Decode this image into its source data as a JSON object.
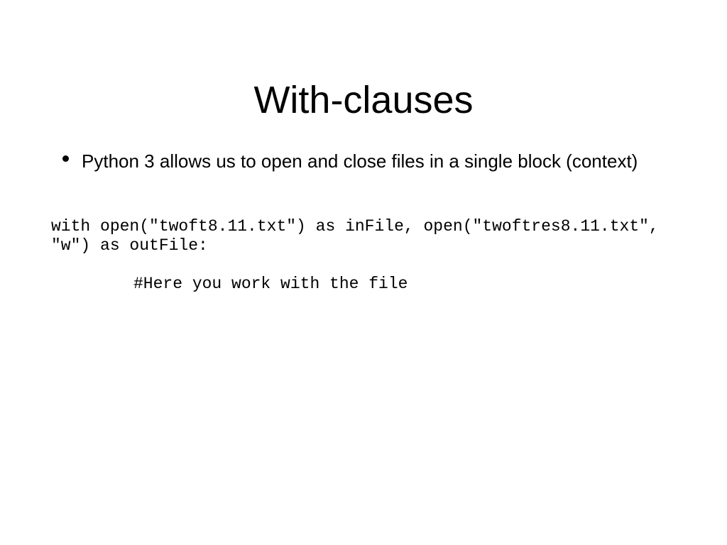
{
  "slide": {
    "title": "With-clauses",
    "background_color": "#ffffff",
    "text_color": "#000000",
    "bullets": [
      {
        "marker": "bullet-dot",
        "text": "Python 3 allows us to open and close files in a single block (context)"
      }
    ],
    "code": {
      "lines": [
        "with open(\"twoft8.11.txt\") as inFile, open(\"twoftres8.11.txt\",",
        "\"w\") as outFile:"
      ],
      "comment": "#Here you work with the file"
    }
  }
}
